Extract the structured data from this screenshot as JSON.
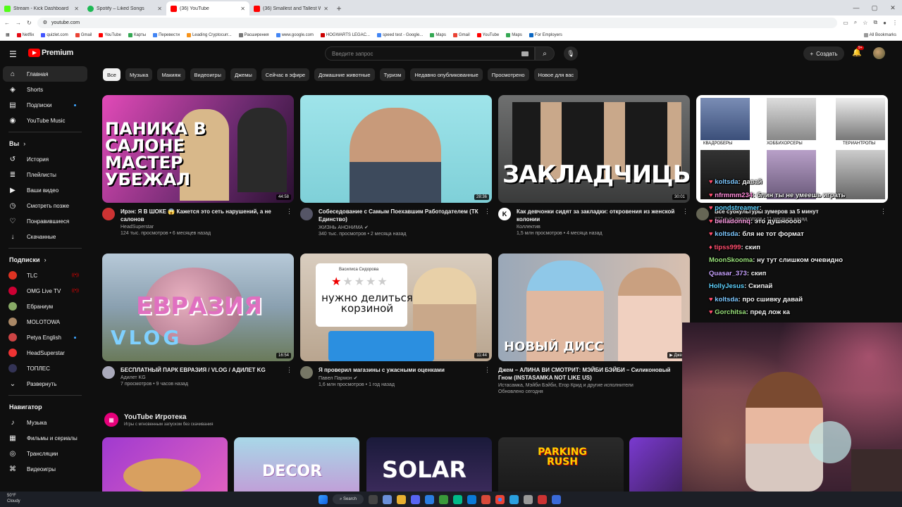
{
  "browser": {
    "tabs": [
      {
        "title": "Stream - Kick Dashboard",
        "color": "#53fc18"
      },
      {
        "title": "Spotify – Liked Songs",
        "color": "#1db954"
      },
      {
        "title": "(36) YouTube",
        "color": "#ff0000",
        "active": true
      },
      {
        "title": "(36) Smallest and Tallest Wome",
        "color": "#ff0000"
      }
    ],
    "url": "youtube.com",
    "bookmarks": [
      "Netflix",
      "quizlet.com",
      "Gmail",
      "YouTube",
      "Карты",
      "Перевести",
      "Leading Cryptocurr...",
      "Расширения",
      "www.google.com",
      "HOGWARTS LEGAC...",
      "speed test - Google...",
      "Maps",
      "Gmail",
      "YouTube",
      "Maps",
      "For Employers"
    ],
    "all_bookmarks": "All Bookmarks"
  },
  "masthead": {
    "logo": "Premium",
    "search_placeholder": "Введите запрос",
    "create": "Создать",
    "notif_count": "9+"
  },
  "sidebar": {
    "main": [
      {
        "label": "Главная",
        "icon": "home-icon",
        "glyph": "⌂"
      },
      {
        "label": "Shorts",
        "icon": "shorts-icon",
        "glyph": "◈"
      },
      {
        "label": "Подписки",
        "icon": "subscriptions-icon",
        "glyph": "▤"
      },
      {
        "label": "YouTube Music",
        "icon": "music-icon",
        "glyph": "◉"
      }
    ],
    "you_header": "Вы",
    "you": [
      {
        "label": "История",
        "icon": "history-icon",
        "glyph": "↺"
      },
      {
        "label": "Плейлисты",
        "icon": "playlists-icon",
        "glyph": "≣"
      },
      {
        "label": "Ваши видео",
        "icon": "your-videos-icon",
        "glyph": "▶"
      },
      {
        "label": "Смотреть позже",
        "icon": "watch-later-icon",
        "glyph": "◷"
      },
      {
        "label": "Понравившиеся",
        "icon": "liked-icon",
        "glyph": "👍"
      },
      {
        "label": "Скачанные",
        "icon": "downloads-icon",
        "glyph": "↓"
      }
    ],
    "subs_header": "Подписки",
    "subs": [
      {
        "label": "TLC",
        "color": "#d32",
        "live": true
      },
      {
        "label": "OMG Live TV",
        "color": "#c03",
        "live": true
      },
      {
        "label": "Ебраниум",
        "color": "#8a6",
        "live": false
      },
      {
        "label": "MOLOTOWA",
        "color": "#a86",
        "live": false
      },
      {
        "label": "Petya English",
        "color": "#c44",
        "live": false,
        "dot": true
      },
      {
        "label": "HeadSuperstar",
        "color": "#e33",
        "live": false
      },
      {
        "label": "ТОПЛЕС",
        "color": "#335",
        "live": false
      }
    ],
    "expand": "Развернуть",
    "nav_header": "Навигатор",
    "nav": [
      {
        "label": "Музыка",
        "icon": "music-note-icon",
        "glyph": "♪"
      },
      {
        "label": "Фильмы и сериалы",
        "icon": "movies-icon",
        "glyph": "▦"
      },
      {
        "label": "Трансляции",
        "icon": "live-icon",
        "glyph": "◎"
      },
      {
        "label": "Видеоигры",
        "icon": "gaming-icon",
        "glyph": "⌘"
      }
    ]
  },
  "chips": [
    "Все",
    "Музыка",
    "Макияж",
    "Видеоигры",
    "Джемы",
    "Сейчас в эфире",
    "Домашние животные",
    "Туризм",
    "Недавно опубликованные",
    "Просмотрено",
    "Новое для вас"
  ],
  "videos": [
    {
      "title": "Ирэн: Я В ШОКЕ 😱 Кажется это сеть нарушений, а не салонов",
      "channel": "HeadSuperstar",
      "stats": "124 тыс. просмотров • 6 месяцев назад",
      "duration": "44:58",
      "thumb_text": "ПАНИКА В САЛОНЕ МАСТЕР УБЕЖАЛ"
    },
    {
      "title": "Собеседование с Самым Поехавшим Работодателем (ТК Единство)",
      "channel": "ЖИЗНЬ АНОНИМА",
      "stats": "340 тыс. просмотров • 2 месяца назад",
      "duration": "28:36",
      "thumb_text": ""
    },
    {
      "title": "Как девчонки сидят за закладки: откровения из женской колонии",
      "channel": "Коллектив",
      "stats": "1,5 млн просмотров • 4 месяца назад",
      "duration": "30:01",
      "thumb_text": "ЗАКЛАДЧИЦЫ"
    },
    {
      "title": "Все субкультуры зумеров за 5 минут",
      "channel": "",
      "stats": "227 тыс. просмотров • 11 месяцев назад",
      "duration": "",
      "thumb_labels": [
        "КВАДРОБЕРЫ",
        "ХОББИХОРСЕРЫ",
        "ТЕРИАНТРОПЫ"
      ]
    },
    {
      "title": "БЕСПЛАТНЫЙ ПАРК ЕВРАЗИЯ / VLOG / АДИЛЕТ KG",
      "channel": "Адилет KG",
      "stats": "7 просмотров • 9 часов назад",
      "duration": "16:54",
      "thumb_text": "ЕВРАЗИЯ",
      "thumb_sub": "VLOG"
    },
    {
      "title": "Я проверил магазины с ужасными оценками",
      "channel": "Павел Пармон",
      "stats": "1,6 млн просмотров • 1 год назад",
      "duration": "11:44",
      "thumb_text": "нужно делиться корзиной",
      "thumb_author": "Василиса Сидорова"
    },
    {
      "title": "Джем – АЛИНА ВИ СМОТРИТ: МЭЙБИ БЭЙБИ – Силиконовый Гном (INSTASAMKA NOT LIKE US)",
      "channel": "Истасамка, Мэйби Бэйби, Егор Крид и другие исполнители",
      "stats": "Обновлено сегодня",
      "duration": "Джем",
      "thumb_text": "НОВЫЙ ДИСС"
    }
  ],
  "playables": {
    "title": "YouTube Игротека",
    "subtitle": "Игры с мгновенным запуском без скачивания",
    "games": [
      "",
      "DECOR",
      "SOLAR",
      "PARKING RUSH",
      ""
    ]
  },
  "chat": [
    {
      "user": "koltsda",
      "text": "давай",
      "color": "#7ec8ff"
    },
    {
      "user": "nfrmmm234",
      "text": "блин ты не умеешь играть",
      "color": "#ff8ad8"
    },
    {
      "user": "pondstreamer",
      "text": "",
      "color": "#5fd3ff"
    },
    {
      "user": "belladonnq",
      "text": "это душноооо",
      "color": "#ff9ee5"
    },
    {
      "user": "koltsda",
      "text": "бля не тот формат",
      "color": "#7ec8ff"
    },
    {
      "user": "tipss999",
      "text": "скип",
      "color": "#ff4d6d"
    },
    {
      "user": "MoonSkooma",
      "text": "ну тут слишком очевидно",
      "color": "#9be37c"
    },
    {
      "user": "Quasar_373",
      "text": "скип",
      "color": "#c9a3ff"
    },
    {
      "user": "HollyJesus",
      "text": "Скипай",
      "color": "#5fd3ff"
    },
    {
      "user": "koltsda",
      "text": "про сшивку давай",
      "color": "#7ec8ff"
    },
    {
      "user": "Gorchitsa",
      "text": "пред лож ка",
      "color": "#9be37c"
    }
  ],
  "taskbar": {
    "temp": "50°F",
    "weather": "Cloudy",
    "search": "Search"
  }
}
